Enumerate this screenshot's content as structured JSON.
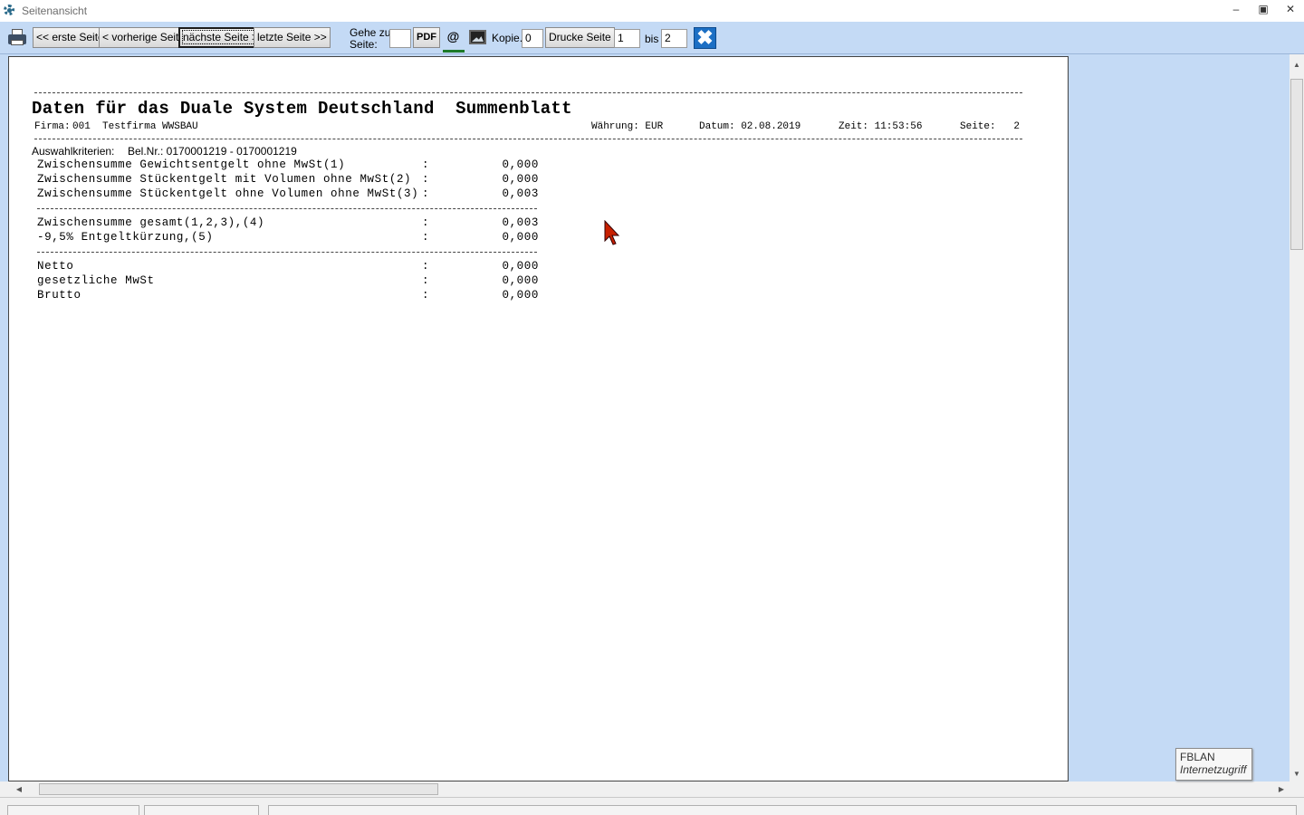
{
  "window": {
    "title": "Seitenansicht",
    "minimize": "–",
    "maximize": "▣",
    "close": "✕"
  },
  "toolbar": {
    "first_page": "<< erste Seite",
    "prev_page": "< vorherige Seite",
    "next_page": "nächste Seite >",
    "last_page": "letzte Seite >>",
    "goto_label_1": "Gehe zu",
    "goto_label_2": "Seite:",
    "goto_value": "",
    "pdf": "PDF",
    "email": "@",
    "copies_label": "Kopie.:",
    "copies_value": "0",
    "print_page": "Drucke Seite",
    "from_value": "1",
    "to_label": "bis",
    "to_value": "2",
    "close_icon": "✖",
    "icons": [
      "printer-icon",
      "email-icon",
      "image-icon",
      "close-icon"
    ]
  },
  "report": {
    "title": "Daten für das Duale System Deutschland  Summenblatt",
    "firma_label": "Firma:",
    "firma_value": "001  Testfirma WWSBAU",
    "waehrung": "Währung: EUR",
    "datum": "Datum: 02.08.2019",
    "zeit": "Zeit: 11:53:56",
    "seite": "Seite:   2",
    "criteria_label": "Auswahlkriterien:",
    "criteria_value": "Bel.Nr.: 0170001219 - 0170001219",
    "rows_group1": [
      {
        "label": "Zwischensumme Gewichtsentgelt ohne MwSt(1)",
        "colon": ":",
        "value": "0,000"
      },
      {
        "label": "Zwischensumme Stückentgelt mit Volumen ohne MwSt(2)",
        "colon": ":",
        "value": "0,000"
      },
      {
        "label": "Zwischensumme Stückentgelt ohne Volumen ohne MwSt(3)",
        "colon": ":",
        "value": "0,003"
      }
    ],
    "rows_group2": [
      {
        "label": "Zwischensumme gesamt(1,2,3),(4)",
        "colon": ":",
        "value": "0,003"
      },
      {
        "label": "-9,5% Entgeltkürzung,(5)",
        "colon": ":",
        "value": "0,000"
      }
    ],
    "rows_group3": [
      {
        "label": "Netto",
        "colon": ":",
        "value": "0,000"
      },
      {
        "label": "gesetzliche MwSt",
        "colon": ":",
        "value": "0,000"
      },
      {
        "label": "Brutto",
        "colon": ":",
        "value": "0,000"
      }
    ]
  },
  "tooltip": {
    "line1": "FBLAN",
    "line2": "Internetzugriff"
  },
  "scroll": {
    "up": "▲",
    "down": "▼",
    "left": "◀",
    "right": "▶"
  },
  "colors": {
    "toolbar_bg": "#c4daf5",
    "preview_bg": "#c4daf5",
    "close_accent": "#1c6fc4",
    "email_indicator": "#1d7a2a",
    "cursor": "#c82000"
  }
}
